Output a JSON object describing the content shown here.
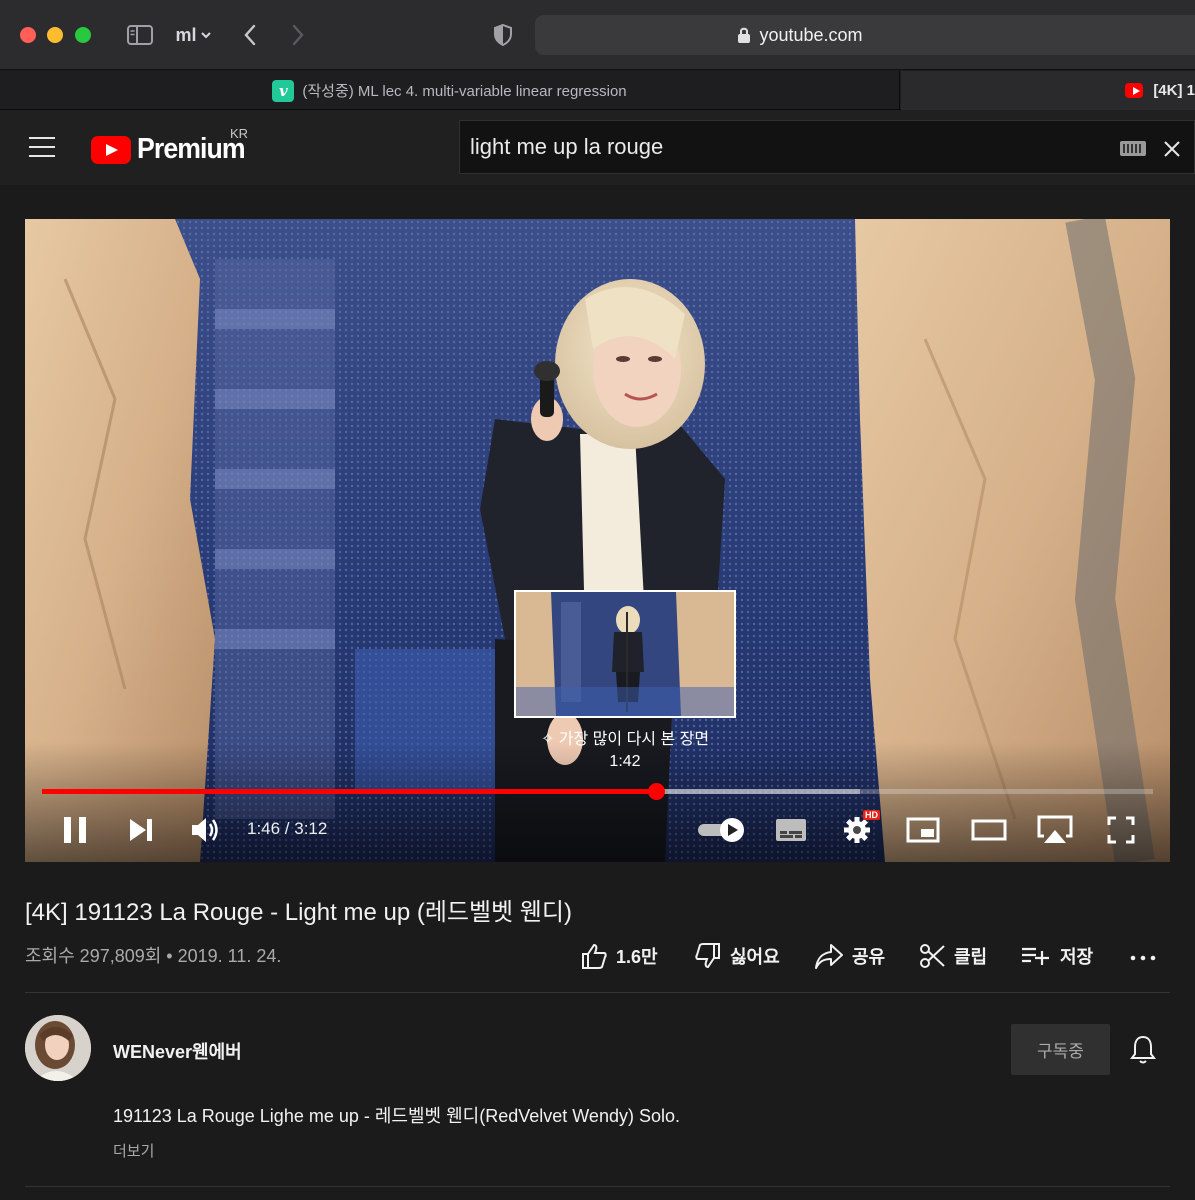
{
  "browser": {
    "group_label": "ml",
    "address": "youtube.com",
    "tabs": [
      {
        "title": "(작성중) ML lec 4. multi-variable linear regression",
        "icon": "velog-icon"
      },
      {
        "title": "[4K] 1",
        "icon": "youtube-icon"
      }
    ]
  },
  "header": {
    "logo_text": "Premium",
    "country": "KR",
    "search_value": "light me up la rouge"
  },
  "player": {
    "current_time": "1:46",
    "duration": "3:12",
    "time_display": "1:46 / 3:12",
    "progress_fraction": 0.553,
    "buffered_fraction": 0.736,
    "preview_label": "가장 많이 다시 본 장면",
    "preview_time": "1:42",
    "preview_fraction": 0.53,
    "settings_badge": "HD"
  },
  "video": {
    "title": "[4K] 191123 La Rouge - Light me up (레드벨벳 웬디)",
    "views": "조회수 297,809회",
    "date": "2019. 11. 24.",
    "meta": "조회수 297,809회 • 2019. 11. 24."
  },
  "actions": {
    "like_count": "1.6만",
    "dislike_label": "싫어요",
    "share_label": "공유",
    "clip_label": "클립",
    "save_label": "저장"
  },
  "channel": {
    "name": "WENever웬에버",
    "subscribe_label": "구독중"
  },
  "description": {
    "text": "191123 La Rouge Lighe me up - 레드벨벳 웬디(RedVelvet Wendy) Solo.",
    "more_label": "더보기"
  },
  "colors": {
    "accent": "#ff0000",
    "background": "#1b1b1b",
    "velog": "#20c997"
  }
}
